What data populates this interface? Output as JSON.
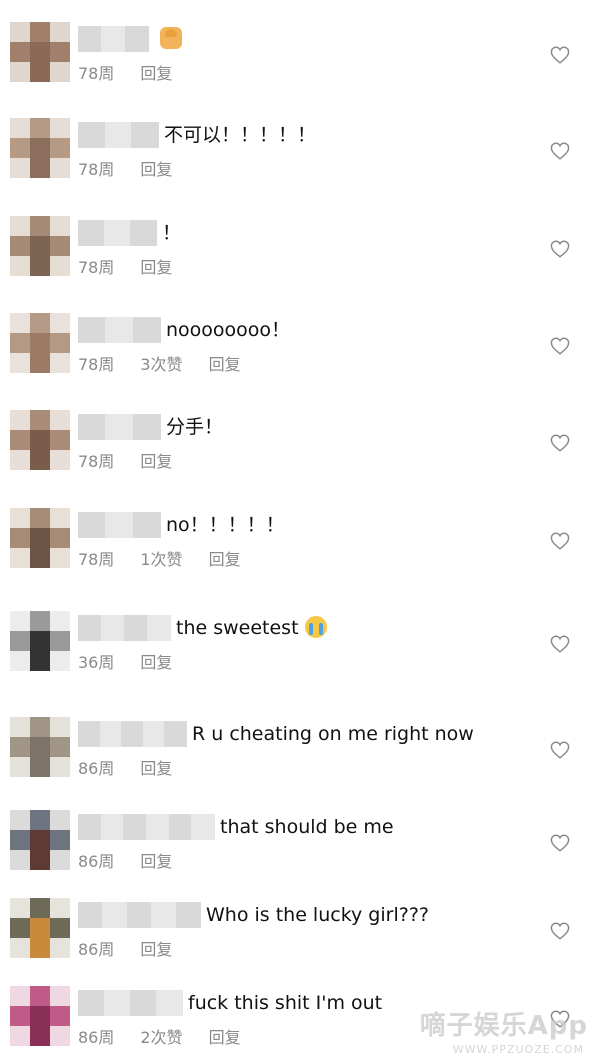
{
  "comments": [
    {
      "text": "",
      "emoji": "person-gesturing-no",
      "age": "78周",
      "likes": "",
      "reply": "回复",
      "avatar_colors": [
        "#8a6a56",
        "#a0806a",
        "#c8b4a4"
      ]
    },
    {
      "text": "不可以！！！！！",
      "emoji": "",
      "age": "78周",
      "likes": "",
      "reply": "回复",
      "avatar_colors": [
        "#8b6e5c",
        "#b59b86",
        "#d2c2b4"
      ]
    },
    {
      "text": "！",
      "emoji": "",
      "age": "78周",
      "likes": "",
      "reply": "回复",
      "avatar_colors": [
        "#7e6452",
        "#a58a76",
        "#d0bfb1"
      ]
    },
    {
      "text": "noooooooo！",
      "emoji": "",
      "age": "78周",
      "likes": "3次赞",
      "reply": "回复",
      "avatar_colors": [
        "#9b7b66",
        "#b49a86",
        "#d7c9bd"
      ]
    },
    {
      "text": "分手！",
      "emoji": "",
      "age": "78周",
      "likes": "",
      "reply": "回复",
      "avatar_colors": [
        "#7a5c4a",
        "#a98c78",
        "#d4c3b6"
      ]
    },
    {
      "text": "no！！！！！",
      "emoji": "",
      "age": "78周",
      "likes": "1次赞",
      "reply": "回复",
      "avatar_colors": [
        "#6e5446",
        "#a68b77",
        "#d5c5b7"
      ]
    },
    {
      "text": "the sweetest",
      "emoji": "crying-face",
      "age": "36周",
      "likes": "",
      "reply": "回复",
      "avatar_colors": [
        "#333333",
        "#9a9a9a",
        "#dcdcdc"
      ]
    },
    {
      "text": "R u cheating on me right now",
      "emoji": "",
      "age": "86周",
      "likes": "",
      "reply": "回复",
      "avatar_colors": [
        "#7d7468",
        "#a19686",
        "#cfc8bd"
      ]
    },
    {
      "text": "that should be me",
      "emoji": "",
      "age": "86周",
      "likes": "",
      "reply": "回复",
      "avatar_colors": [
        "#5d3a34",
        "#6e7480",
        "#bdbdbd"
      ]
    },
    {
      "text": "Who is the lucky girl???",
      "emoji": "",
      "age": "86周",
      "likes": "",
      "reply": "回复",
      "avatar_colors": [
        "#c98a3c",
        "#6e6a58",
        "#d2ccc0"
      ]
    },
    {
      "text": "fuck this shit I'm out",
      "emoji": "",
      "age": "86周",
      "likes": "2次赞",
      "reply": "回复",
      "avatar_colors": [
        "#8a2f55",
        "#c05a87",
        "#e3b8cb"
      ]
    }
  ],
  "watermark": {
    "main": "嘀子娱乐App",
    "sub": "WWW.PPZUOZE.COM"
  }
}
